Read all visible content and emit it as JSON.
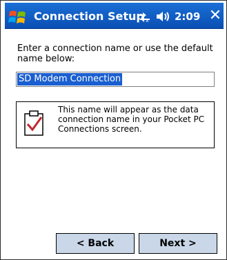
{
  "titlebar": {
    "title": "Connection Setup",
    "time": "2:09",
    "close_label": "✕",
    "accent_color": "#0b4fb3"
  },
  "main": {
    "prompt": "Enter a connection name or use the default name below:",
    "name_value": "SD Modem Connection",
    "info_text": "This name will appear as the data connection name in your Pocket PC Connections screen."
  },
  "buttons": {
    "back_label": "< Back",
    "next_label": "Next >"
  },
  "icons": {
    "start": "windows-flag-icon",
    "connectivity": "connectivity-icon",
    "volume": "speaker-icon",
    "info": "clipboard-check-icon"
  }
}
